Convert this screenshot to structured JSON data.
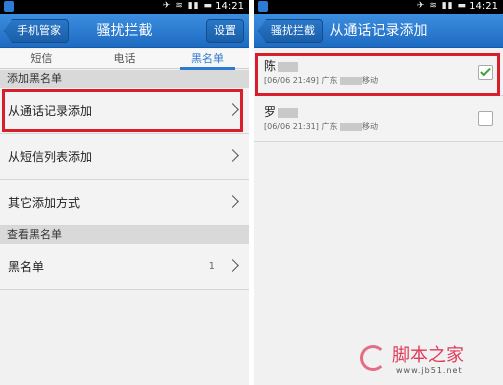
{
  "status": {
    "time": "14:21"
  },
  "left_screen": {
    "back_label": "手机管家",
    "title": "骚扰拦截",
    "settings_label": "设置",
    "tabs": [
      {
        "label": "短信",
        "active": false
      },
      {
        "label": "电话",
        "active": false
      },
      {
        "label": "黑名单",
        "active": true
      }
    ],
    "section_add": "添加黑名单",
    "rows": [
      {
        "label": "从通话记录添加"
      },
      {
        "label": "从短信列表添加"
      },
      {
        "label": "其它添加方式"
      }
    ],
    "section_view": "查看黑名单",
    "blacklist": {
      "label": "黑名单",
      "count": "1"
    }
  },
  "right_screen": {
    "back_label": "骚扰拦截",
    "title": "从通话记录添加",
    "contacts": [
      {
        "name": "陈",
        "time": "[06/06 21:49]",
        "location": "广东",
        "carrier": "移动",
        "checked": true
      },
      {
        "name": "罗",
        "time": "[06/06 21:31]",
        "location": "广东",
        "carrier": "移动",
        "checked": false
      }
    ]
  },
  "watermark": {
    "text": "脚本之家",
    "url": "www.jb51.net"
  },
  "colors": {
    "title_bar": "#2a7ed4",
    "highlight": "#d81e2a",
    "tab_active": "#2c7bd0"
  }
}
